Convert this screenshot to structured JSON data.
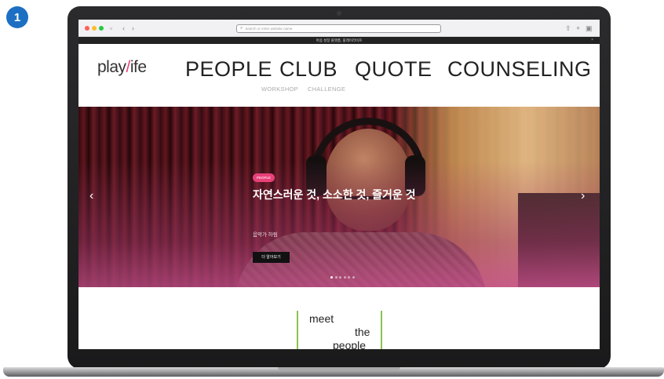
{
  "step_badge": "1",
  "browser": {
    "url_placeholder": "Search or enter website name",
    "back_icon": "chevron-left-icon",
    "forward_icon": "chevron-right-icon",
    "sidebar_icon": "sidebar-icon",
    "share_icon": "share-icon",
    "new_tab_icon": "plus-icon",
    "tabs_icon": "tabs-icon"
  },
  "announcement": {
    "text": "마음 성장 플랫폼, 플레이라이프",
    "close": "×"
  },
  "site": {
    "logo_part1": "play",
    "logo_slash": "/",
    "logo_part2": "ife",
    "nav": [
      "PEOPLE",
      "CLUB",
      "QUOTE",
      "COUNSELING"
    ],
    "sub_nav": [
      "WORKSHOP",
      "CHALLENGE"
    ]
  },
  "hero": {
    "badge": "PEOPLE",
    "title": "자연스러운 것, 소소한 것, 즐거운 것",
    "author": "음악가 하림",
    "button": "더 알아보기",
    "prev": "‹",
    "next": "›",
    "slide_count": 6,
    "active_slide": 1
  },
  "meet": {
    "line1": "meet",
    "line2": "the",
    "line3": "people"
  },
  "colors": {
    "accent_pink": "#e9407a",
    "badge_blue": "#1d6fc4",
    "meet_green": "#8cc152"
  }
}
